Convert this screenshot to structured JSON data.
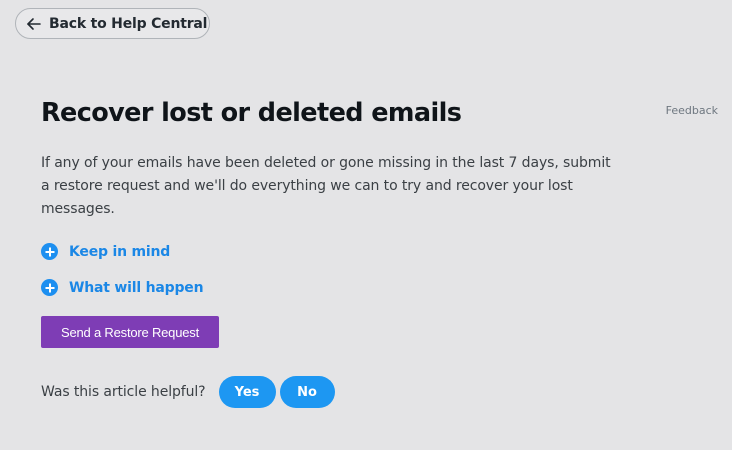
{
  "nav": {
    "back_label": "Back to Help Central"
  },
  "article": {
    "title": "Recover lost or deleted emails",
    "feedback_label": "Feedback",
    "intro": "If any of your emails have been deleted or gone missing in the last 7 days, submit a restore request and we'll do everything we can to try and recover your lost messages.",
    "sections": [
      {
        "label": "Keep in mind",
        "icon": "plus-circle-icon"
      },
      {
        "label": "What will happen",
        "icon": "plus-circle-icon"
      }
    ],
    "action_button_label": "Send a Restore Request"
  },
  "helpful": {
    "question": "Was this article helpful?",
    "yes_label": "Yes",
    "no_label": "No"
  },
  "colors": {
    "background": "#e4e4e6",
    "link_blue": "#1b87e6",
    "accent_purple": "#7e3db5",
    "pill_blue": "#1d97f2"
  }
}
